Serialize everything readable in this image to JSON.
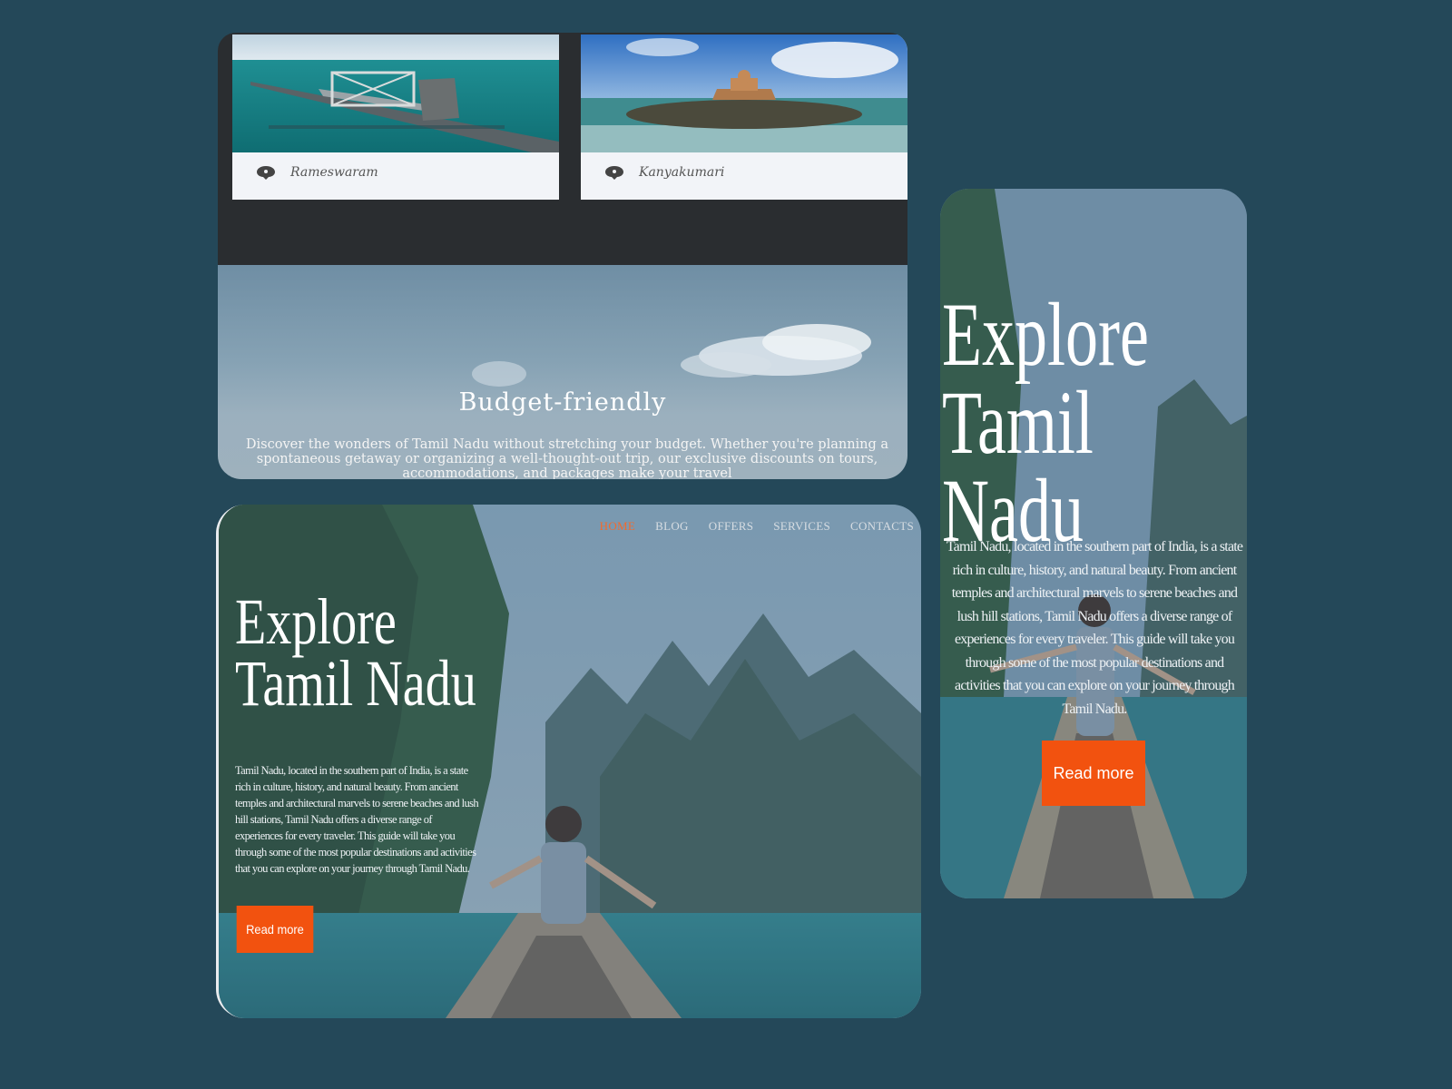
{
  "destinations": [
    {
      "name": "Rameswaram",
      "icon": "location-pin-icon"
    },
    {
      "name": "Kanyakumari",
      "icon": "location-pin-icon"
    }
  ],
  "budget": {
    "title": "Budget-friendly",
    "text": "Discover the wonders of Tamil Nadu without stretching your budget. Whether you're planning a spontaneous getaway or organizing a well-thought-out trip, our exclusive discounts on tours, accommodations, and packages make your travel"
  },
  "nav": {
    "home": "HOME",
    "blog": "BLOG",
    "offers": "OFFERS",
    "services": "SERVICES",
    "contacts": "CONTACTS"
  },
  "hero": {
    "title_line1": "Explore",
    "title_line2": "Tamil Nadu",
    "description": "Tamil Nadu, located in the southern part of India, is a state rich in culture, history, and natural beauty. From ancient temples and architectural marvels to serene beaches and lush hill stations, Tamil Nadu offers a diverse range of experiences for every traveler. This guide will take you through some of the most popular destinations and activities that you can explore on your journey through Tamil Nadu.",
    "button": "Read more"
  },
  "colors": {
    "background": "#244859",
    "accent": "#f2520f",
    "nav_active": "#f26a2e"
  }
}
